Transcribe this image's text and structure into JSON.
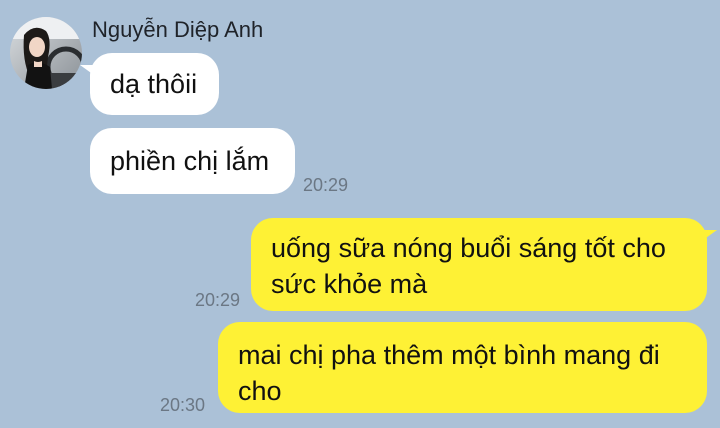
{
  "contact": {
    "name": "Nguyễn Diệp Anh"
  },
  "messages": [
    {
      "side": "incoming",
      "text": "dạ thôii",
      "time": ""
    },
    {
      "side": "incoming",
      "text": "phiền chị lắm",
      "time": "20:29"
    },
    {
      "side": "outgoing",
      "text": "uống sữa nóng buổi sáng tốt cho sức khỏe mà",
      "time": "20:29"
    },
    {
      "side": "outgoing",
      "text": "mai chị pha thêm một bình mang đi cho",
      "time": "20:30"
    }
  ],
  "colors": {
    "background": "#abc1d7",
    "incoming_bubble": "#ffffff",
    "outgoing_bubble": "#fef135",
    "timestamp": "#6b7784"
  }
}
